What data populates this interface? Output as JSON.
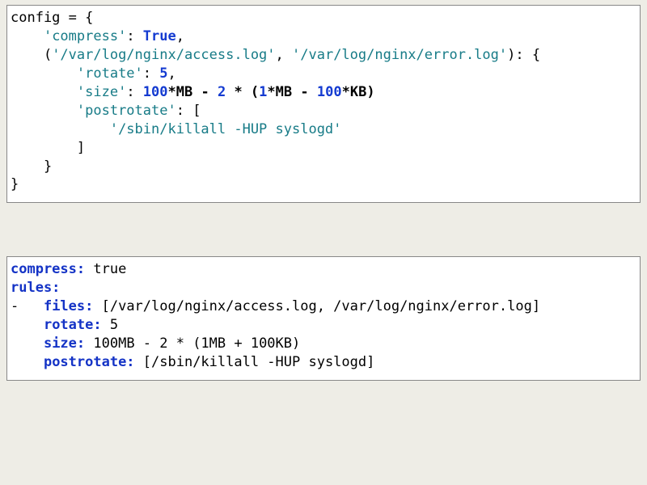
{
  "python": {
    "l1_a": "config = {",
    "l2_a": "    ",
    "l2_str1": "'compress'",
    "l2_b": ": ",
    "l2_true": "True",
    "l2_c": ",",
    "l3_a": "    (",
    "l3_s1": "'/var/log/nginx/access.log'",
    "l3_b": ", ",
    "l3_s2": "'/var/log/nginx/error.log'",
    "l3_c": "): {",
    "l4_a": "        ",
    "l4_s": "'rotate'",
    "l4_b": ": ",
    "l4_n": "5",
    "l4_c": ",",
    "l5_a": "        ",
    "l5_s": "'size'",
    "l5_b": ": ",
    "l5_n1": "100",
    "l5_op1": "*",
    "l5_id1": "MB",
    "l5_op2": " - ",
    "l5_n2": "2",
    "l5_op3": " * (",
    "l5_n3": "1",
    "l5_op4": "*",
    "l5_id2": "MB",
    "l5_op5": " - ",
    "l5_n4": "100",
    "l5_op6": "*",
    "l5_id3": "KB",
    "l5_op7": ")",
    "l6_a": "        ",
    "l6_s": "'postrotate'",
    "l6_b": ": [",
    "l7_a": "            ",
    "l7_s": "'/sbin/killall -HUP syslogd'",
    "l8": "        ]",
    "l9": "    }",
    "l10": "}"
  },
  "yaml": {
    "l1_k": "compress:",
    "l1_v": " true",
    "l2_k": "rules:",
    "l3_d": "-   ",
    "l3_k": "files:",
    "l3_v": " [/var/log/nginx/access.log, /var/log/nginx/error.log]",
    "l4_a": "    ",
    "l4_k": "rotate:",
    "l4_v": " 5",
    "l5_a": "    ",
    "l5_k": "size:",
    "l5_v": " 100MB - 2 * (1MB + 100KB)",
    "l6_a": "    ",
    "l6_k": "postrotate:",
    "l6_v": " [/sbin/killall -HUP syslogd]"
  }
}
